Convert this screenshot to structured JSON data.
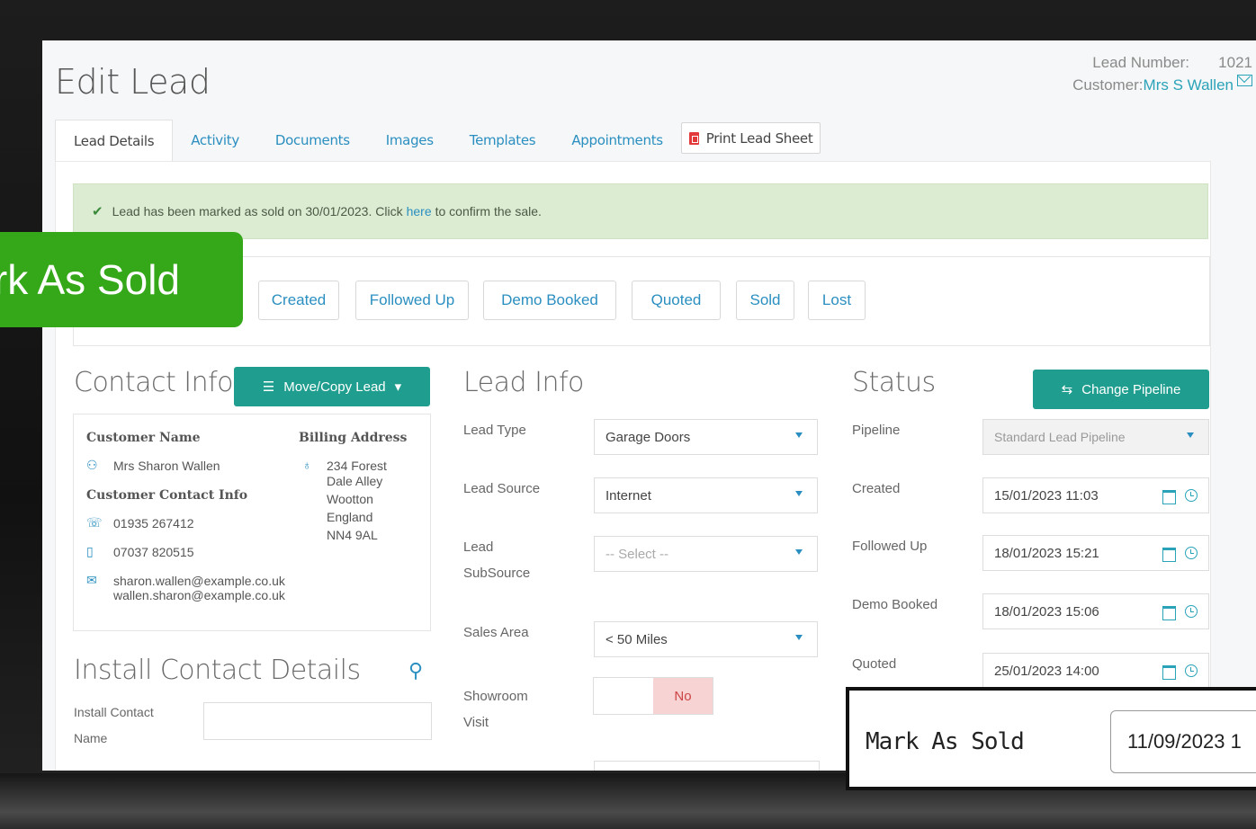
{
  "header": {
    "title": "Edit Lead",
    "lead_number_label": "Lead Number:",
    "lead_number": "1021",
    "customer_label": "Customer:",
    "customer_name": "Mrs S Wallen"
  },
  "tabs": [
    "Lead Details",
    "Activity",
    "Documents",
    "Images",
    "Templates",
    "Appointments"
  ],
  "print_button": "Print Lead Sheet",
  "alert": {
    "prefix": "Lead has been marked as sold on 30/01/2023. Click",
    "link": "here",
    "suffix": "to confirm the sale."
  },
  "stages": [
    "Created",
    "Followed Up",
    "Demo Booked",
    "Quoted",
    "Sold",
    "Lost"
  ],
  "contact": {
    "title": "Contact Info",
    "move_button": "Move/Copy Lead",
    "customer_name_label": "Customer Name",
    "customer_name": "Mrs Sharon Wallen",
    "contact_info_label": "Customer Contact Info",
    "phone": "01935 267412",
    "mobile": "07037 820515",
    "email1": "sharon.wallen@example.co.uk",
    "email2": "wallen.sharon@example.co.uk",
    "billing_label": "Billing Address",
    "address": [
      "234 Forest",
      "Dale Alley",
      "Wootton",
      "England",
      "NN4 9AL"
    ]
  },
  "install": {
    "title": "Install Contact Details",
    "name_label_1": "Install Contact",
    "name_label_2": "Name"
  },
  "lead_info": {
    "title": "Lead Info",
    "lead_type_label": "Lead Type",
    "lead_type": "Garage Doors",
    "lead_source_label": "Lead Source",
    "lead_source": "Internet",
    "subsource_label_1": "Lead",
    "subsource_label_2": "SubSource",
    "subsource": "-- Select --",
    "sales_area_label": "Sales Area",
    "sales_area": "< 50 Miles",
    "showroom_label_1": "Showroom",
    "showroom_label_2": "Visit",
    "showroom_value": "No"
  },
  "status": {
    "title": "Status",
    "change_button": "Change Pipeline",
    "pipeline_label": "Pipeline",
    "pipeline": "Standard Lead Pipeline",
    "created_label": "Created",
    "created": "15/01/2023 11:03",
    "followed_label": "Followed Up",
    "followed": "18/01/2023 15:21",
    "demo_label": "Demo Booked",
    "demo": "18/01/2023 15:06",
    "quoted_label": "Quoted",
    "quoted": "25/01/2023 14:00"
  },
  "callouts": {
    "banner": "Mark As Sold",
    "panel_label": "Mark As Sold",
    "panel_value": "11/09/2023 1"
  },
  "colors": {
    "teal": "#1f9e8f",
    "link": "#2a8fc0",
    "alert_bg": "#dcecd3",
    "banner_green": "#35a81a"
  }
}
